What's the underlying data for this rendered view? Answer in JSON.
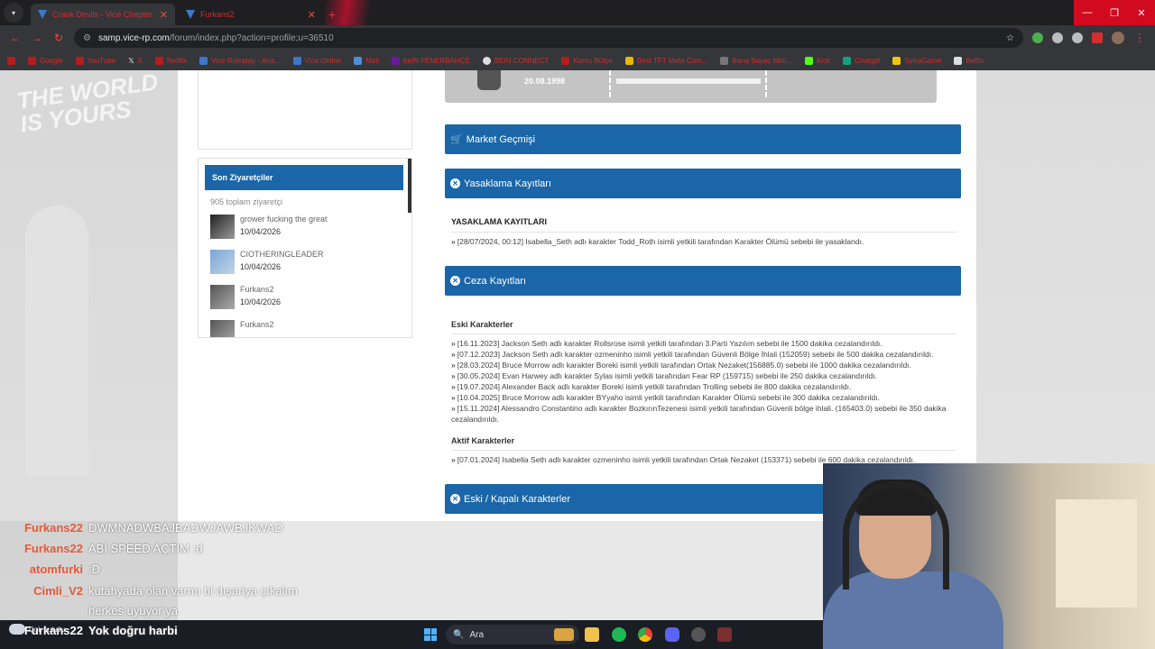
{
  "browser": {
    "tabs": [
      {
        "title": "Crank Devils - Vice Chapter - ..."
      },
      {
        "title": "Furkans2"
      }
    ],
    "url_host": "samp.vice-rp.com",
    "url_path": "/forum/index.php?action=profile;u=36510",
    "bookmarks": [
      "Google",
      "YouTube",
      "X",
      "Netflix",
      "Vice Roleplay - Ana...",
      "Vice Online",
      "Mail",
      "beIN FENERBAHÇE",
      "BEIN CONNECT",
      "Kamu Bütçe",
      "Best TFT Meta Com...",
      "Baraj Sayaç Mini...",
      "Kick",
      "Chatgpt",
      "SylvaGame",
      "Betfix"
    ]
  },
  "profile": {
    "dob": "20.08.1998"
  },
  "visitors": {
    "title": "Son Ziyaretçiler",
    "total": "905 toplam ziyaretçi",
    "items": [
      {
        "name": "grower fucking the great",
        "date": "10/04/2026"
      },
      {
        "name": "CIOTHERINGLEADER",
        "date": "10/04/2026"
      },
      {
        "name": "Furkans2",
        "date": "10/04/2026"
      },
      {
        "name": "Furkans2",
        "date": ""
      }
    ]
  },
  "panels": {
    "market": "Market Geçmişi",
    "bans": "Yasaklama Kayıtları",
    "penalties": "Ceza Kayıtları",
    "characters": "Eski / Kapalı Karakterler"
  },
  "bans": {
    "title": "YASAKLAMA KAYITLARI",
    "entries": [
      "[28/07/2024, 00:12] Isabella_Seth adlı karakter Todd_Roth isimli yetkili tarafından Karakter Ölümü sebebi ile yasaklandı."
    ]
  },
  "penalties": {
    "old_title": "Eski Karakterler",
    "old": [
      "[16.11.2023] Jackson Seth adlı karakter Rollsrose isimli yetkili tarafından 3.Parti Yazılım sebebi ile 1500 dakika cezalandırıldı.",
      "[07.12.2023] Jackson Seth adlı karakter ozmeninho isimli yetkili tarafından Güvenli Bölge İhlali (152059) sebebi ile 500 dakika cezalandırıldı.",
      "[28.03.2024] Bruce Morrow adlı karakter Boreki isimli yetkili tarafından Ortak Nezaket(156885.0) sebebi ile 1000 dakika cezalandırıldı.",
      "[30.05.2024] Evan Harwey adlı karakter Sylas isimli yetkili tarafından Fear RP (159715) sebebi ile 250 dakika cezalandırıldı.",
      "[19.07.2024] Alexander Back adlı karakter Boreki isimli yetkili tarafından Trolling sebebi ile 800 dakika cezalandırıldı.",
      "[10.04.2025] Bruce Morrow adlı karakter BYyaho isimli yetkili tarafından Karakter Ölümü sebebi ile 300 dakika cezalandırıldı.",
      "[15.11.2024] Alessandro Constantino adlı karakter BozkırınTezenesi isimli yetkili tarafından Güvenli bölge ihlali. (165403.0) sebebi ile 350 dakika cezalandırıldı."
    ],
    "active_title": "Aktif Karakterler",
    "active": [
      "[07.01.2024] Isabella Seth adlı karakter ozmeninho isimli yetkili tarafından Ortak Nezaket (153371) sebebi ile 600 dakika cezalandırıldı."
    ]
  },
  "chat": [
    {
      "user": "Furkans22",
      "msg": "DWMNADWBAJBADWJAWBJKWAD"
    },
    {
      "user": "Furkans22",
      "msg": "ABİ SPEED AÇTIM :d"
    },
    {
      "user": "atomfurki",
      "msg": ":D"
    },
    {
      "user": "Cimli_V2",
      "msg": "kutahyada olan varmı bi dışariya çıkalım"
    },
    {
      "user": "",
      "msg": "herkes uyuyor ya"
    },
    {
      "user": "Furkans22",
      "msg": "Yok doğru harbi"
    }
  ],
  "taskbar": {
    "weather": "Çok bulutlu",
    "search": "Ara"
  },
  "colors": {
    "accent": "#1a66a8",
    "chrome_dark": "#35363a",
    "chat_user": "#e25c3a"
  }
}
